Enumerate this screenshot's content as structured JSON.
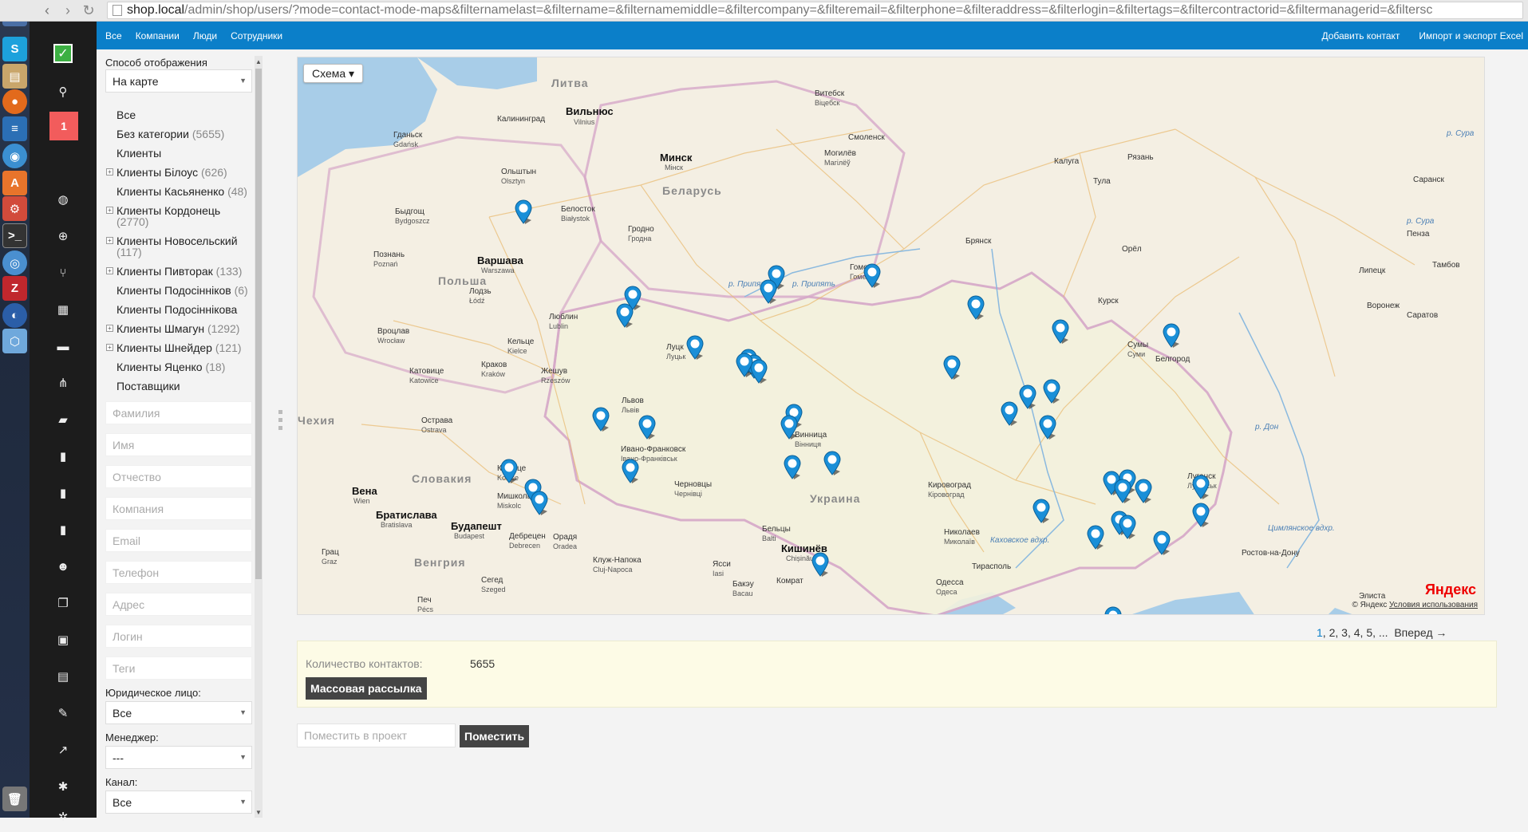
{
  "browser": {
    "url_host": "shop.local",
    "url_path": "/admin/shop/users/?mode=contact-mode-maps&filternamelast=&filtername=&filternamemiddle=&filtercompany=&filteremail=&filterphone=&filteraddress=&filterlogin=&filtertags=&filtercontractorid=&filtermanagerid=&filtersc"
  },
  "topnav": {
    "left": [
      "Все",
      "Компании",
      "Люди",
      "Сотрудники"
    ],
    "right": [
      "Добавить контакт",
      "Импорт и экспорт Excel"
    ]
  },
  "sidebar": {
    "badge": "1",
    "icons": [
      "search-icon",
      "globe-icon",
      "plus-circle-icon",
      "fork-icon",
      "calendar-icon",
      "chat-icon",
      "sitemap-icon",
      "folder-icon",
      "clipboard-icon",
      "clipboard-icon",
      "clipboard-icon",
      "users-icon",
      "copy-icon",
      "money-icon",
      "gift-icon",
      "paperclip-icon",
      "chart-icon",
      "gear-icon",
      "gears-icon"
    ]
  },
  "filters": {
    "display_mode_label": "Способ отображения",
    "display_mode_value": "На карте",
    "categories": [
      {
        "label": "Все",
        "count": "",
        "expandable": false
      },
      {
        "label": "Без категории",
        "count": "(5655)",
        "expandable": false
      },
      {
        "label": "Клиенты",
        "count": "",
        "expandable": false
      },
      {
        "label": "Клиенты Білоус",
        "count": "(626)",
        "expandable": true
      },
      {
        "label": "Клиенты Касьяненко",
        "count": "(48)",
        "expandable": false
      },
      {
        "label": "Клиенты Кордонець",
        "count": "(2770)",
        "expandable": true
      },
      {
        "label": "Клиенты Новосельский",
        "count": "(117)",
        "expandable": true
      },
      {
        "label": "Клиенты Пивторак",
        "count": "(133)",
        "expandable": true
      },
      {
        "label": "Клиенты Подосінніков",
        "count": "(6)",
        "expandable": false
      },
      {
        "label": "Клиенты Подосіннікова",
        "count": "",
        "expandable": false
      },
      {
        "label": "Клиенты Шмагун",
        "count": "(1292)",
        "expandable": true
      },
      {
        "label": "Клиенты Шнейдер",
        "count": "(121)",
        "expandable": true
      },
      {
        "label": "Клиенты Яценко",
        "count": "(18)",
        "expandable": false
      },
      {
        "label": "Поставщики",
        "count": "",
        "expandable": false
      }
    ],
    "placeholders": {
      "lastname": "Фамилия",
      "name": "Имя",
      "middlename": "Отчество",
      "company": "Компания",
      "email": "Email",
      "phone": "Телефон",
      "address": "Адрес",
      "login": "Логин",
      "tags": "Теги"
    },
    "legal_label": "Юридическое лицо:",
    "legal_value": "Все",
    "manager_label": "Менеджер:",
    "manager_value": "---",
    "channel_label": "Канал:",
    "channel_value": "Все"
  },
  "map": {
    "type_button": "Схема",
    "labels": {
      "countries": [
        "Литва",
        "Беларусь",
        "Польша",
        "Украина",
        "Словакия",
        "Чехия",
        "Венгрия"
      ],
      "cities": [
        {
          "ru": "Вильнюс",
          "local": "Vilnius"
        },
        {
          "ru": "Минск",
          "local": "Мінск"
        },
        {
          "ru": "Варшава",
          "local": "Warszawa"
        },
        {
          "ru": "Вена",
          "local": "Wien"
        },
        {
          "ru": "Братислава",
          "local": "Bratislava"
        },
        {
          "ru": "Будапешт",
          "local": "Budapest"
        },
        {
          "ru": "Кишинёв",
          "local": "Chișinău"
        }
      ],
      "towns": [
        {
          "ru": "Гданьск",
          "local": "Gdańsk"
        },
        {
          "ru": "Калининград",
          "local": ""
        },
        {
          "ru": "Ольштын",
          "local": "Olsztyn"
        },
        {
          "ru": "Белосток",
          "local": "Białystok"
        },
        {
          "ru": "Быдгощ",
          "local": "Bydgoszcz"
        },
        {
          "ru": "Познань",
          "local": "Poznań"
        },
        {
          "ru": "Лодзь",
          "local": "Łódź"
        },
        {
          "ru": "Вроцлав",
          "local": "Wrocław"
        },
        {
          "ru": "Катовице",
          "local": "Katowice"
        },
        {
          "ru": "Краков",
          "local": "Kraków"
        },
        {
          "ru": "Кельце",
          "local": "Kielce"
        },
        {
          "ru": "Люблин",
          "local": "Lublin"
        },
        {
          "ru": "Жешув",
          "local": "Rzeszów"
        },
        {
          "ru": "Острава",
          "local": "Ostrava"
        },
        {
          "ru": "Кошице",
          "local": "Košice"
        },
        {
          "ru": "Мишкольц",
          "local": "Miskolc"
        },
        {
          "ru": "Дебрецен",
          "local": "Debrecen"
        },
        {
          "ru": "Орадя",
          "local": "Oradea"
        },
        {
          "ru": "Клуж-Напока",
          "local": "Cluj-Napoca"
        },
        {
          "ru": "Ясси",
          "local": "Iasi"
        },
        {
          "ru": "Бакэу",
          "local": "Bacau"
        },
        {
          "ru": "Сегед",
          "local": "Szeged"
        },
        {
          "ru": "Печ",
          "local": "Pécs"
        },
        {
          "ru": "Грац",
          "local": "Graz"
        },
        {
          "ru": "Гродно",
          "local": "Гродна"
        },
        {
          "ru": "Витебск",
          "local": "Віцебск"
        },
        {
          "ru": "Могилёв",
          "local": "Магілёў"
        },
        {
          "ru": "Гомель",
          "local": "Гомель"
        },
        {
          "ru": "Смоленск",
          "local": ""
        },
        {
          "ru": "Брянск",
          "local": ""
        },
        {
          "ru": "Калуга",
          "local": ""
        },
        {
          "ru": "Тула",
          "local": ""
        },
        {
          "ru": "Рязань",
          "local": ""
        },
        {
          "ru": "Саранск",
          "local": ""
        },
        {
          "ru": "Пенза",
          "local": ""
        },
        {
          "ru": "Тамбов",
          "local": ""
        },
        {
          "ru": "Липецк",
          "local": ""
        },
        {
          "ru": "Орёл",
          "local": ""
        },
        {
          "ru": "Курск",
          "local": ""
        },
        {
          "ru": "Воронеж",
          "local": ""
        },
        {
          "ru": "Саратов",
          "local": ""
        },
        {
          "ru": "Белгород",
          "local": ""
        },
        {
          "ru": "Сумы",
          "local": "Суми"
        },
        {
          "ru": "Луцк",
          "local": "Луцьк"
        },
        {
          "ru": "Львов",
          "local": "Львів"
        },
        {
          "ru": "Ивано-Франковск",
          "local": "Івано-Франківськ"
        },
        {
          "ru": "Черновцы",
          "local": "Чернівці"
        },
        {
          "ru": "Винница",
          "local": "Вінниця"
        },
        {
          "ru": "Кировоград",
          "local": "Кіровоград"
        },
        {
          "ru": "Николаев",
          "local": "Миколаїв"
        },
        {
          "ru": "Тирасполь",
          "local": ""
        },
        {
          "ru": "Одесса",
          "local": "Одеса"
        },
        {
          "ru": "Бельцы",
          "local": "Balti"
        },
        {
          "ru": "Комрат",
          "local": ""
        },
        {
          "ru": "Луганск",
          "local": "Луганськ"
        },
        {
          "ru": "Ростов-на-Дону",
          "local": ""
        },
        {
          "ru": "Элиста",
          "local": ""
        }
      ],
      "rivers": [
        "р. Припять",
        "р. Припять",
        "р. Сура",
        "р. Сура",
        "р. Дон",
        "Цимлянское вдхр.",
        "Каховское вдхр."
      ]
    },
    "markers": 42,
    "attribution": "© Яндекс",
    "terms": "Условия использования",
    "logo": "Яндекс"
  },
  "pagination": {
    "pages": [
      "1",
      "2",
      "3",
      "4",
      "5"
    ],
    "ellipsis": "...",
    "next": "Вперед →"
  },
  "summary": {
    "count_label": "Количество контактов:",
    "count_value": "5655",
    "mass_mail_button": "Массовая рассылка",
    "project_placeholder": "Поместить в проект",
    "project_button": "Поместить"
  },
  "colors": {
    "topnav": "#0b7fc9",
    "sidebar": "#1c1c1c",
    "badge": "#f25c5c",
    "check": "#3cb043",
    "marker": "#1a8fd8"
  }
}
